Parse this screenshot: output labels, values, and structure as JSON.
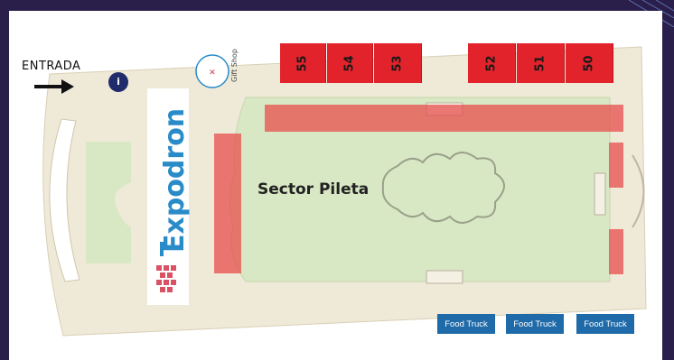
{
  "entrance": {
    "label": "ENTRADA"
  },
  "info_pin": {
    "icon": "info-icon",
    "glyph": "i"
  },
  "gift_shop": {
    "label": "Gift Shop",
    "logo_text": "Expodron"
  },
  "brand": {
    "name": "Expodron",
    "color": "#2a8bc9"
  },
  "stands": [
    {
      "number": "55"
    },
    {
      "number": "54"
    },
    {
      "number": "53"
    },
    {
      "number": "52"
    },
    {
      "number": "51"
    },
    {
      "number": "50"
    }
  ],
  "sector": {
    "label": "Sector Pileta"
  },
  "food_trucks": [
    {
      "label": "Food Truck"
    },
    {
      "label": "Food Truck"
    },
    {
      "label": "Food Truck"
    }
  ],
  "colors": {
    "stand": "#e3232c",
    "highlight": "#e84848",
    "lawn": "#d9e8c4",
    "floor": "#efe9d8",
    "food_truck": "#1f6aa8",
    "background": "#2a1f4a"
  }
}
